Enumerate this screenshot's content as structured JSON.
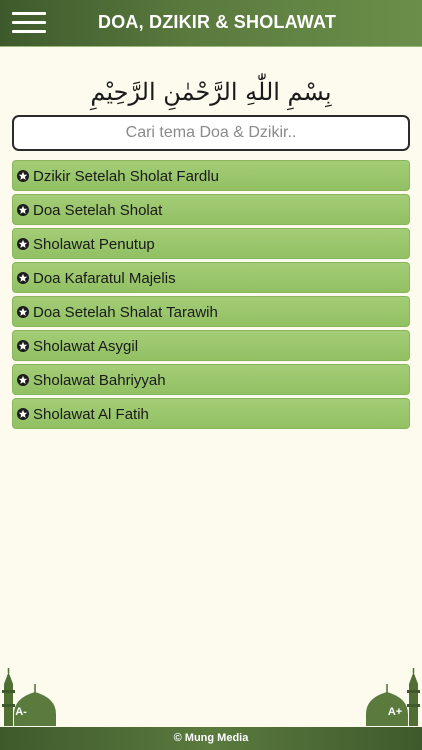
{
  "header": {
    "title": "DOA, DZIKIR & SHOLAWAT",
    "menu_icon": "hamburger-menu-icon"
  },
  "basmalah": "بِسْمِ اللّٰهِ الرَّحْمٰنِ الرَّحِيْمِ",
  "search": {
    "placeholder": "Cari tema Doa & Dzikir..",
    "value": ""
  },
  "list": {
    "items": [
      {
        "label": "Dzikir Setelah Sholat Fardlu"
      },
      {
        "label": "Doa Setelah Sholat"
      },
      {
        "label": "Sholawat Penutup"
      },
      {
        "label": "Doa Kafaratul Majelis"
      },
      {
        "label": "Doa Setelah Shalat Tarawih"
      },
      {
        "label": "Sholawat Asygil"
      },
      {
        "label": "Sholawat Bahriyyah"
      },
      {
        "label": "Sholawat Al Fatih"
      }
    ],
    "item_icon": "star-icon"
  },
  "font_controls": {
    "decrease_label": "A-",
    "increase_label": "A+",
    "icon": "mosque-icon"
  },
  "footer": {
    "text": "© Mung Media"
  },
  "colors": {
    "header": "#4d6b35",
    "background": "#fcfbee",
    "list_item": "#9bc86c",
    "footer": "#4d6b35"
  }
}
